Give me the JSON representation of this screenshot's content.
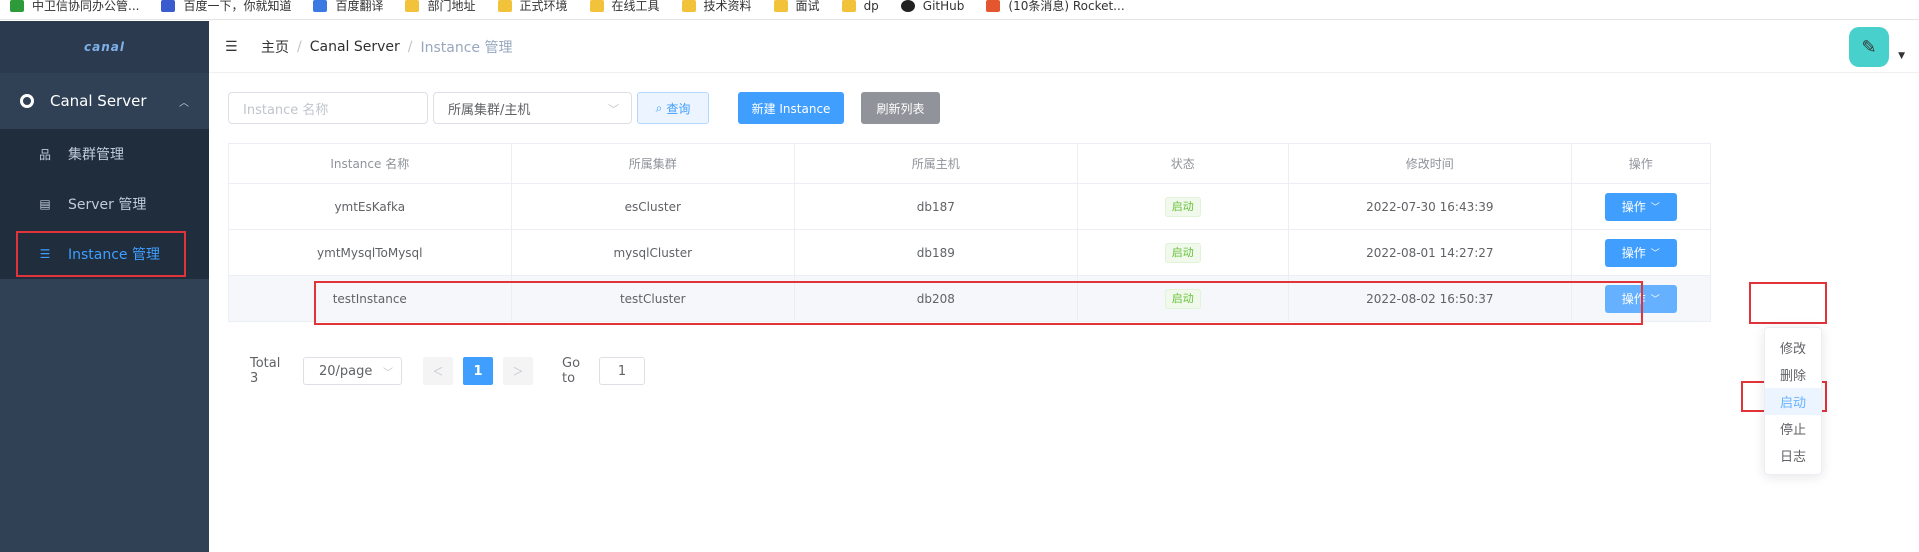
{
  "bookmarks": [
    {
      "label": "中卫信协同办公管...",
      "color": "#2e9b3a"
    },
    {
      "label": "百度一下，你就知道",
      "color": "#3b5ccf"
    },
    {
      "label": "百度翻译",
      "color": "#3b7ae0"
    },
    {
      "label": "部门地址",
      "color": "#f3c23b"
    },
    {
      "label": "正式环境",
      "color": "#f3c23b"
    },
    {
      "label": "在线工具",
      "color": "#f3c23b"
    },
    {
      "label": "技术资料",
      "color": "#f3c23b"
    },
    {
      "label": "面试",
      "color": "#f3c23b"
    },
    {
      "label": "dp",
      "color": "#f3c23b"
    },
    {
      "label": "GitHub",
      "color": "#222222"
    },
    {
      "label": "(10条消息) Rocket...",
      "color": "#e4572e"
    }
  ],
  "sidebar": {
    "logo": "canal",
    "group_label": "Canal Server",
    "items": [
      {
        "label": "集群管理",
        "icon": "sitemap-icon"
      },
      {
        "label": "Server 管理",
        "icon": "document-icon"
      },
      {
        "label": "Instance 管理",
        "icon": "list-icon",
        "active": true
      }
    ]
  },
  "header": {
    "breadcrumb": [
      "主页",
      "Canal Server",
      "Instance 管理"
    ]
  },
  "filter": {
    "name_placeholder": "Instance 名称",
    "cluster_select": "所属集群/主机",
    "query_label": "查询",
    "new_label": "新建 Instance",
    "refresh_label": "刷新列表"
  },
  "table": {
    "columns": [
      "Instance 名称",
      "所属集群",
      "所属主机",
      "状态",
      "修改时间",
      "操作"
    ],
    "rows": [
      {
        "name": "ymtEsKafka",
        "cluster": "esCluster",
        "host": "db187",
        "status": "启动",
        "time": "2022-07-30 16:43:39",
        "op": "操作"
      },
      {
        "name": "ymtMysqlToMysql",
        "cluster": "mysqlCluster",
        "host": "db189",
        "status": "启动",
        "time": "2022-08-01 14:27:27",
        "op": "操作"
      },
      {
        "name": "testInstance",
        "cluster": "testCluster",
        "host": "db208",
        "status": "启动",
        "time": "2022-08-02 16:50:37",
        "op": "操作"
      }
    ]
  },
  "pagination": {
    "total": "Total 3",
    "page_size": "20/page",
    "current_page": "1",
    "goto_label": "Go to",
    "goto_value": "1"
  },
  "dropdown": {
    "items": [
      "修改",
      "删除",
      "启动",
      "停止",
      "日志"
    ],
    "active_index": 2
  },
  "colors": {
    "primary": "#409eff",
    "sidebar": "#304156",
    "highlight": "#e0333a",
    "success": "#67c23a"
  }
}
